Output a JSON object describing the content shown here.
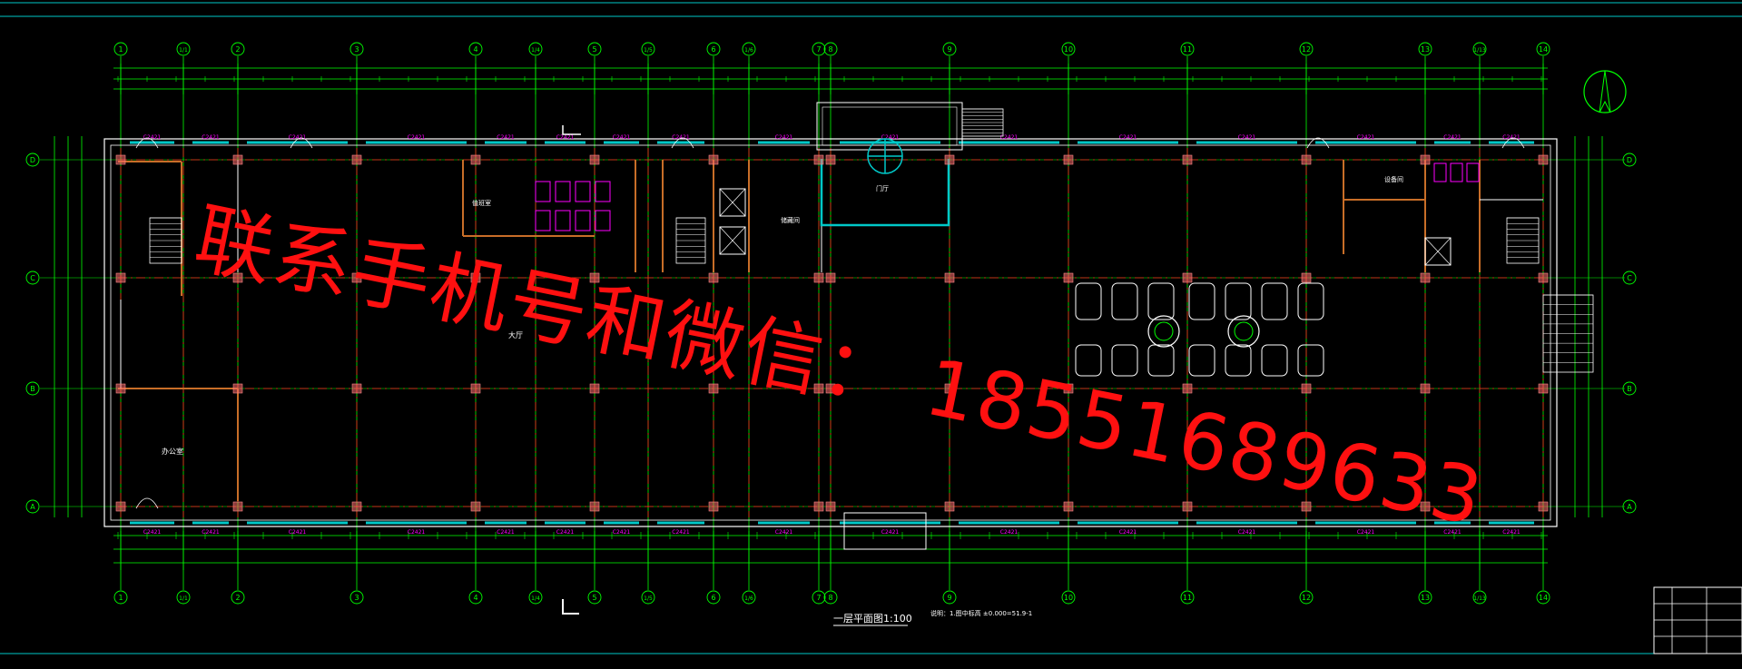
{
  "drawing": {
    "plan_title": "一层平面图1:100",
    "note": "说明：1.图中标高 ±0.000=51.9-1",
    "north_symbol": "north-arrow"
  },
  "watermark": {
    "text": "联系手机号和微信： 18551689633"
  },
  "axes": {
    "columns": [
      "1",
      "1/1",
      "2",
      "3",
      "4",
      "1/4",
      "5",
      "1/5",
      "6",
      "1/6",
      "7",
      "8",
      "9",
      "10",
      "11",
      "12",
      "13",
      "1/13",
      "14"
    ],
    "rows": [
      "D",
      "C",
      "B",
      "A"
    ]
  },
  "rooms": {
    "office_left": "办公室",
    "hall": "大厅",
    "lobby_left": "门厅",
    "duty_room": "值班室",
    "storage": "储藏间",
    "equipment": "设备间"
  },
  "colors": {
    "background": "#000000",
    "dimension_lines": "#00ff00",
    "axis_lines": "#ff2020",
    "walls": "#ffffff",
    "windows": "#00c8c8",
    "annotations": "#ff00ff",
    "columns_fill": "#ff6b6b",
    "watermark": "#ff1010"
  }
}
